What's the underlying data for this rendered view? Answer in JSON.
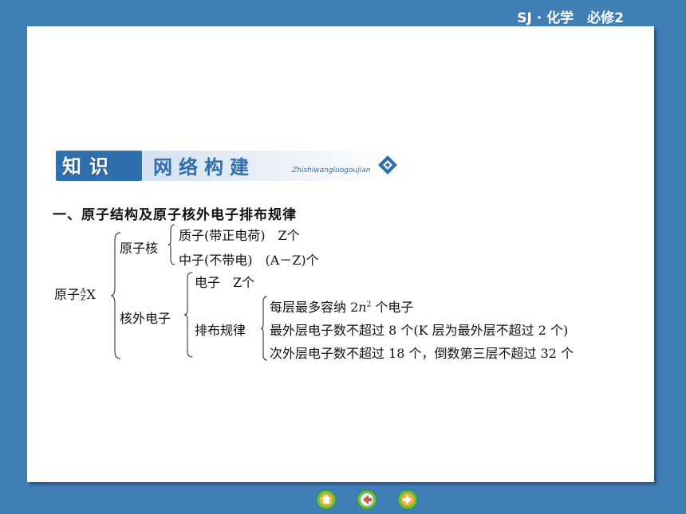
{
  "header": {
    "tag": "SJ · 化学　必修2"
  },
  "banner": {
    "left_label": "知识",
    "right_label": "网络构建",
    "pinyin": "Zhishiwangluogoujian"
  },
  "section": {
    "title": "一、原子结构及原子核外电子排布规律"
  },
  "tree": {
    "root_word": "原子",
    "root_mass": "A",
    "root_atomic": "Z",
    "root_symbol": "X",
    "nucleus": {
      "label": "原子核",
      "proton": "质子(带正电荷)　Z个",
      "neutron": "中子(不带电)　(A－Z)个"
    },
    "electrons": {
      "label": "核外电子",
      "electron": "电子　Z个",
      "rules_label": "排布规律",
      "rule1_pre": "每层最多容纳 2",
      "rule1_var": "n",
      "rule1_sup": "2",
      "rule1_post": " 个电子",
      "rule2": "最外层电子数不超过 8 个(K 层为最外层不超过 2 个)",
      "rule3": "次外层电子数不超过 18 个，倒数第三层不超过 32 个"
    }
  },
  "nav": {
    "home_icon": "home-icon",
    "back_icon": "back-icon",
    "forward_icon": "forward-icon"
  }
}
